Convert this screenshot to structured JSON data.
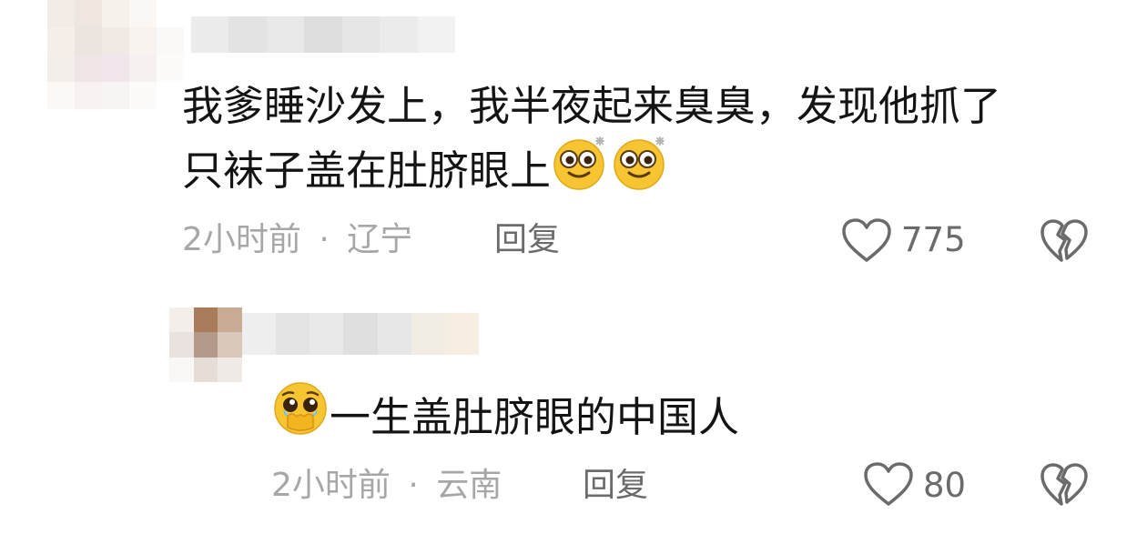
{
  "comments": [
    {
      "text_line1": "我爹睡沙发上，我半夜起来臭臭，发现他抓了",
      "text_line2": "只袜子盖在肚脐眼上",
      "emojis": [
        "dazzled-eyes-emoji",
        "dazzled-eyes-emoji"
      ],
      "time": "2小时前",
      "separator": "·",
      "location": "辽宁",
      "reply_label": "回复",
      "like_count": "775"
    },
    {
      "text": "一生盖肚脐眼的中国人",
      "emoji": "holding-back-tears-emoji",
      "time": "2小时前",
      "separator": "·",
      "location": "云南",
      "reply_label": "回复",
      "like_count": "80"
    }
  ],
  "colors": {
    "text": "#141414",
    "meta": "#a7a7a7",
    "secondary": "#6b6b6b",
    "emoji_yellow": "#f6c531"
  }
}
